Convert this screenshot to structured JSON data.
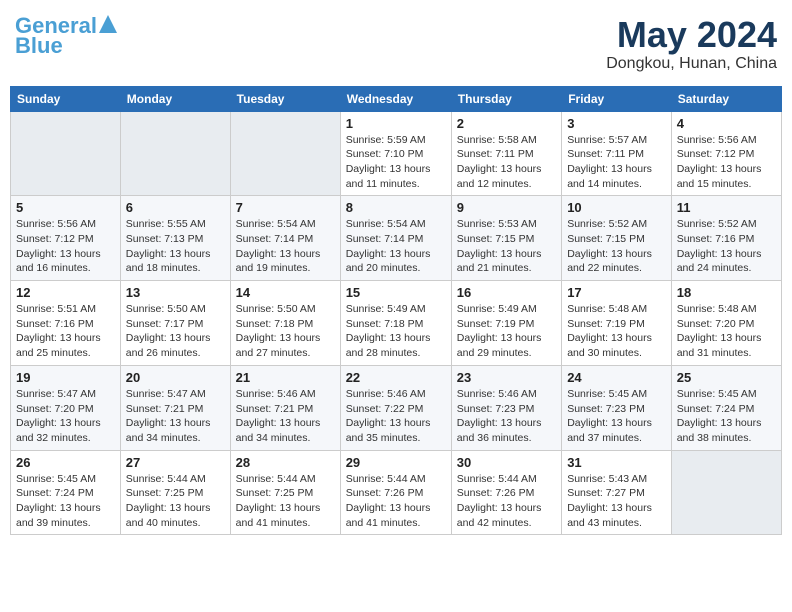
{
  "header": {
    "logo_line1": "General",
    "logo_line2": "Blue",
    "month_title": "May 2024",
    "location": "Dongkou, Hunan, China"
  },
  "days_of_week": [
    "Sunday",
    "Monday",
    "Tuesday",
    "Wednesday",
    "Thursday",
    "Friday",
    "Saturday"
  ],
  "weeks": [
    [
      {
        "num": "",
        "info": ""
      },
      {
        "num": "",
        "info": ""
      },
      {
        "num": "",
        "info": ""
      },
      {
        "num": "1",
        "info": "Sunrise: 5:59 AM\nSunset: 7:10 PM\nDaylight: 13 hours\nand 11 minutes."
      },
      {
        "num": "2",
        "info": "Sunrise: 5:58 AM\nSunset: 7:11 PM\nDaylight: 13 hours\nand 12 minutes."
      },
      {
        "num": "3",
        "info": "Sunrise: 5:57 AM\nSunset: 7:11 PM\nDaylight: 13 hours\nand 14 minutes."
      },
      {
        "num": "4",
        "info": "Sunrise: 5:56 AM\nSunset: 7:12 PM\nDaylight: 13 hours\nand 15 minutes."
      }
    ],
    [
      {
        "num": "5",
        "info": "Sunrise: 5:56 AM\nSunset: 7:12 PM\nDaylight: 13 hours\nand 16 minutes."
      },
      {
        "num": "6",
        "info": "Sunrise: 5:55 AM\nSunset: 7:13 PM\nDaylight: 13 hours\nand 18 minutes."
      },
      {
        "num": "7",
        "info": "Sunrise: 5:54 AM\nSunset: 7:14 PM\nDaylight: 13 hours\nand 19 minutes."
      },
      {
        "num": "8",
        "info": "Sunrise: 5:54 AM\nSunset: 7:14 PM\nDaylight: 13 hours\nand 20 minutes."
      },
      {
        "num": "9",
        "info": "Sunrise: 5:53 AM\nSunset: 7:15 PM\nDaylight: 13 hours\nand 21 minutes."
      },
      {
        "num": "10",
        "info": "Sunrise: 5:52 AM\nSunset: 7:15 PM\nDaylight: 13 hours\nand 22 minutes."
      },
      {
        "num": "11",
        "info": "Sunrise: 5:52 AM\nSunset: 7:16 PM\nDaylight: 13 hours\nand 24 minutes."
      }
    ],
    [
      {
        "num": "12",
        "info": "Sunrise: 5:51 AM\nSunset: 7:16 PM\nDaylight: 13 hours\nand 25 minutes."
      },
      {
        "num": "13",
        "info": "Sunrise: 5:50 AM\nSunset: 7:17 PM\nDaylight: 13 hours\nand 26 minutes."
      },
      {
        "num": "14",
        "info": "Sunrise: 5:50 AM\nSunset: 7:18 PM\nDaylight: 13 hours\nand 27 minutes."
      },
      {
        "num": "15",
        "info": "Sunrise: 5:49 AM\nSunset: 7:18 PM\nDaylight: 13 hours\nand 28 minutes."
      },
      {
        "num": "16",
        "info": "Sunrise: 5:49 AM\nSunset: 7:19 PM\nDaylight: 13 hours\nand 29 minutes."
      },
      {
        "num": "17",
        "info": "Sunrise: 5:48 AM\nSunset: 7:19 PM\nDaylight: 13 hours\nand 30 minutes."
      },
      {
        "num": "18",
        "info": "Sunrise: 5:48 AM\nSunset: 7:20 PM\nDaylight: 13 hours\nand 31 minutes."
      }
    ],
    [
      {
        "num": "19",
        "info": "Sunrise: 5:47 AM\nSunset: 7:20 PM\nDaylight: 13 hours\nand 32 minutes."
      },
      {
        "num": "20",
        "info": "Sunrise: 5:47 AM\nSunset: 7:21 PM\nDaylight: 13 hours\nand 34 minutes."
      },
      {
        "num": "21",
        "info": "Sunrise: 5:46 AM\nSunset: 7:21 PM\nDaylight: 13 hours\nand 34 minutes."
      },
      {
        "num": "22",
        "info": "Sunrise: 5:46 AM\nSunset: 7:22 PM\nDaylight: 13 hours\nand 35 minutes."
      },
      {
        "num": "23",
        "info": "Sunrise: 5:46 AM\nSunset: 7:23 PM\nDaylight: 13 hours\nand 36 minutes."
      },
      {
        "num": "24",
        "info": "Sunrise: 5:45 AM\nSunset: 7:23 PM\nDaylight: 13 hours\nand 37 minutes."
      },
      {
        "num": "25",
        "info": "Sunrise: 5:45 AM\nSunset: 7:24 PM\nDaylight: 13 hours\nand 38 minutes."
      }
    ],
    [
      {
        "num": "26",
        "info": "Sunrise: 5:45 AM\nSunset: 7:24 PM\nDaylight: 13 hours\nand 39 minutes."
      },
      {
        "num": "27",
        "info": "Sunrise: 5:44 AM\nSunset: 7:25 PM\nDaylight: 13 hours\nand 40 minutes."
      },
      {
        "num": "28",
        "info": "Sunrise: 5:44 AM\nSunset: 7:25 PM\nDaylight: 13 hours\nand 41 minutes."
      },
      {
        "num": "29",
        "info": "Sunrise: 5:44 AM\nSunset: 7:26 PM\nDaylight: 13 hours\nand 41 minutes."
      },
      {
        "num": "30",
        "info": "Sunrise: 5:44 AM\nSunset: 7:26 PM\nDaylight: 13 hours\nand 42 minutes."
      },
      {
        "num": "31",
        "info": "Sunrise: 5:43 AM\nSunset: 7:27 PM\nDaylight: 13 hours\nand 43 minutes."
      },
      {
        "num": "",
        "info": ""
      }
    ]
  ]
}
